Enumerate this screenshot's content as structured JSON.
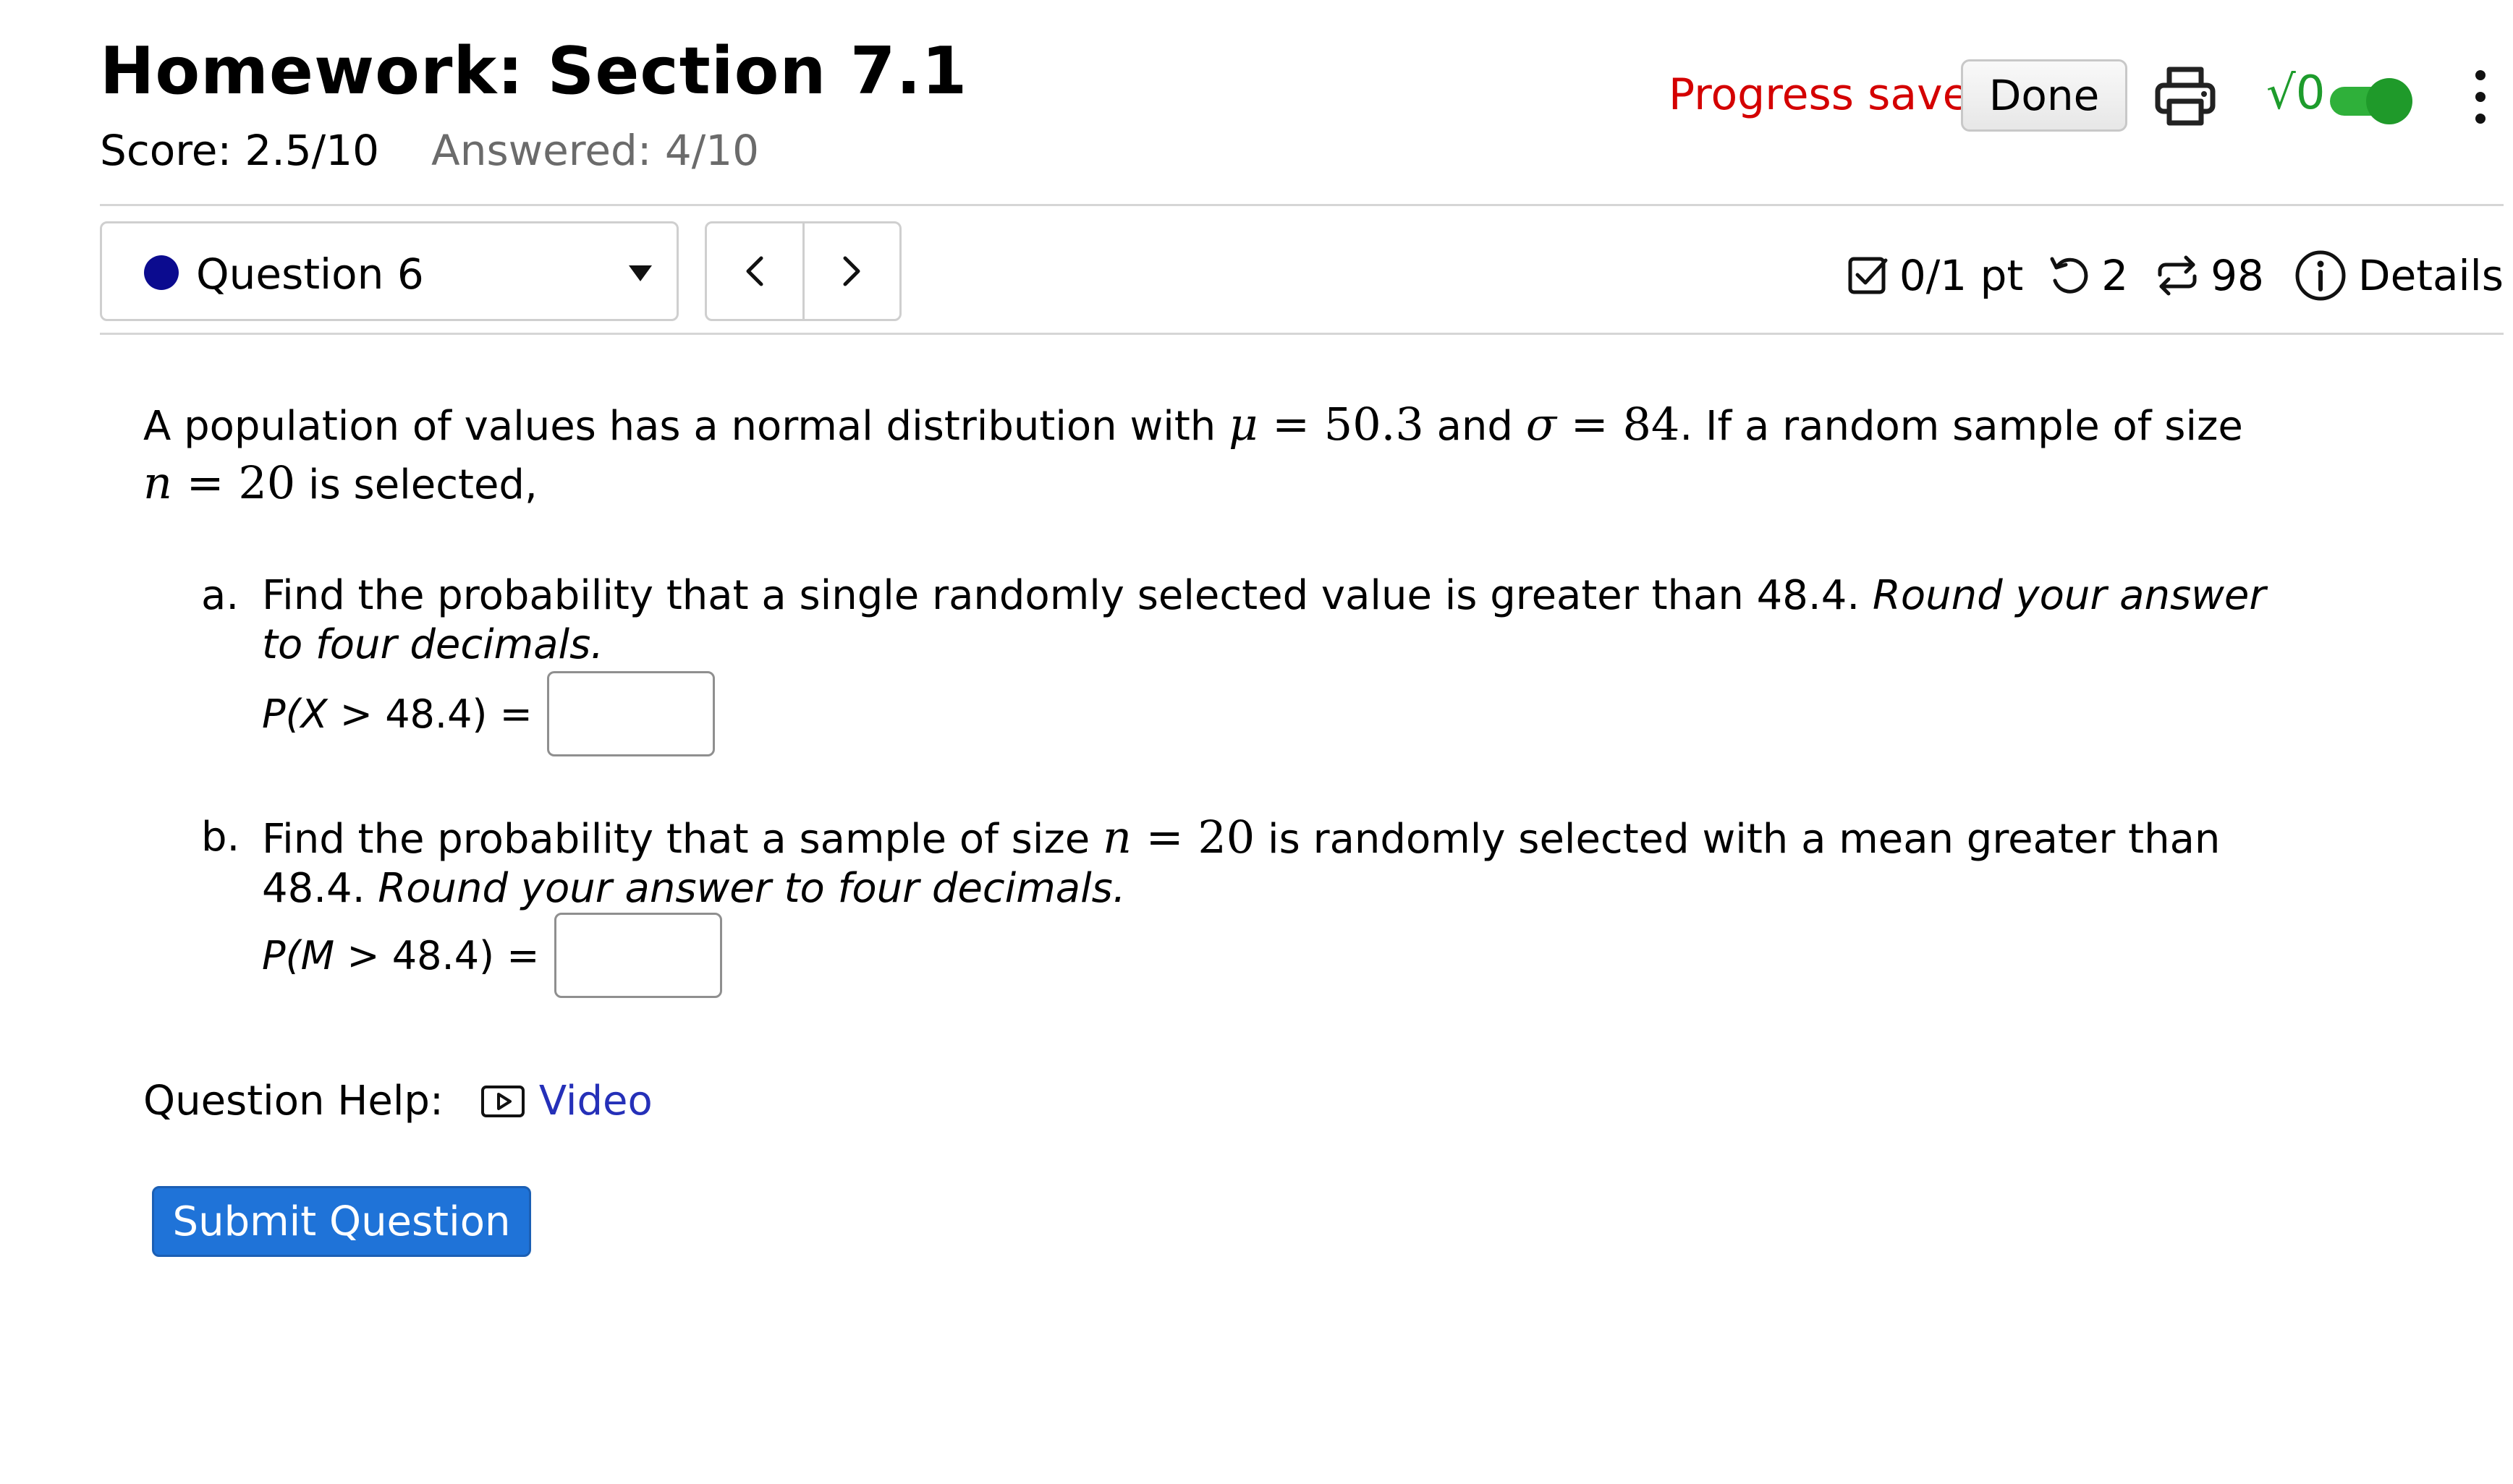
{
  "header": {
    "title": "Homework: Section 7.1",
    "score": "Score: 2.5/10",
    "answered": "Answered: 4/10",
    "progress_status": "Progress saved",
    "done_label": "Done",
    "math_toggle_label": "√0",
    "math_toggle_on": true
  },
  "question_nav": {
    "selected_question": "Question 6",
    "status_dot_color": "#0b0b8f",
    "points": "0/1 pt",
    "retries": "2",
    "attempts": "98",
    "details_label": "Details"
  },
  "question": {
    "stem_intro": "A population of values has a normal distribution with ",
    "mu_symbol": "μ",
    "mu_value": "50.3",
    "and_word": " and ",
    "sigma_symbol": "σ",
    "sigma_value": "84",
    "stem_mid": ". If a random sample of size ",
    "n_symbol": "n",
    "n_value": "20",
    "stem_end": " is selected,",
    "parts": [
      {
        "letter": "a.",
        "text": "Find the probability that a single randomly selected value is greater than 48.4. ",
        "instruction": "Round your answer to four decimals.",
        "answer_label_var": "P(X",
        "answer_label_rest": " > 48.4) =",
        "answer_value": ""
      },
      {
        "letter": "b.",
        "text_before": "Find the probability that a sample of size ",
        "n_symbol": "n",
        "n_value": "20",
        "text_after": " is randomly selected with a mean greater than 48.4. ",
        "instruction": "Round your answer to four decimals.",
        "answer_label_var": "P(M",
        "answer_label_rest": " > 48.4) =",
        "answer_value": ""
      }
    ]
  },
  "help": {
    "label": "Question Help:",
    "video_label": "Video"
  },
  "submit_label": "Submit Question",
  "colors": {
    "progress_saved": "#d40000",
    "toggle_on": "#2fb03a",
    "link": "#2530b8",
    "submit_bg": "#1f73d8"
  }
}
